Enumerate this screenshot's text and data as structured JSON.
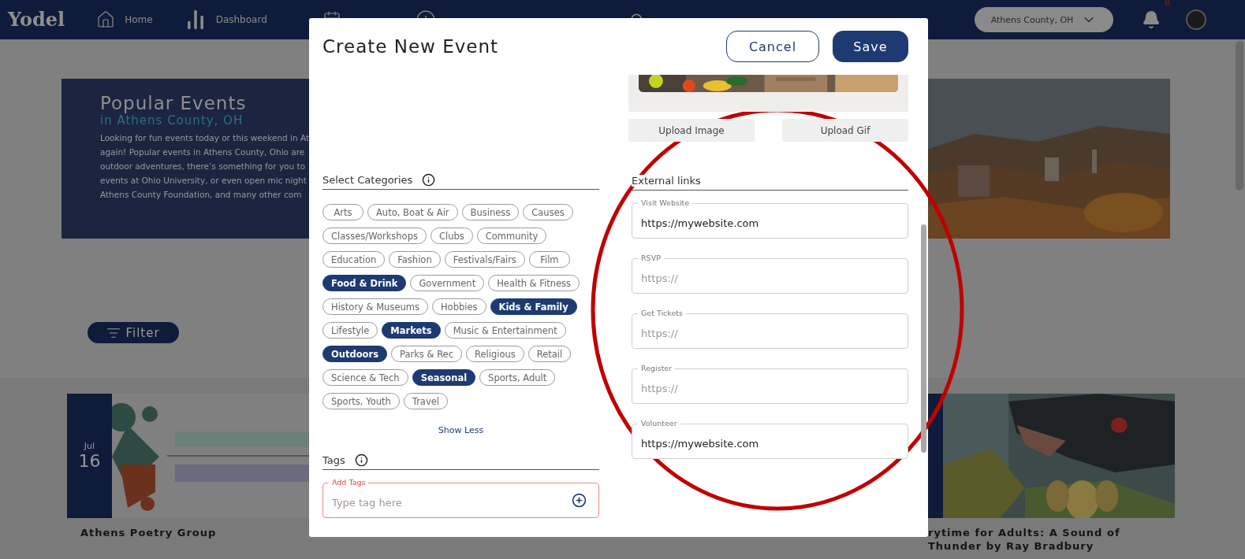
{
  "nav": {
    "logo": "Yodel",
    "items": [
      {
        "label": "Home"
      },
      {
        "label": "Dashboard"
      }
    ],
    "location": "Athens County, OH",
    "notification_count": "8"
  },
  "hero": {
    "title": "Popular Events",
    "subtitle": "in Athens County, OH",
    "lines": [
      "Looking for fun events today or this weekend in At",
      "again! Popular events in Athens County, Ohio are",
      "outdoor adventures, there’s something for you to",
      "events at Ohio University, or even open mic night",
      "Athens County Foundation, and many other com"
    ]
  },
  "filter": {
    "label": "Filter"
  },
  "cards": [
    {
      "month": "Jul",
      "day": "16",
      "title": "Athens Poetry Group"
    },
    {
      "title": "rytime for Adults: A Sound of Thunder by Ray Bradbury"
    }
  ],
  "modal": {
    "title": "Create New Event",
    "cancel": "Cancel",
    "save": "Save",
    "upload_buttons": [
      "Upload Image",
      "Upload Gif"
    ],
    "categories": {
      "heading": "Select Categories",
      "items": [
        {
          "label": "Arts",
          "selected": false
        },
        {
          "label": "Auto, Boat & Air",
          "selected": false
        },
        {
          "label": "Business",
          "selected": false
        },
        {
          "label": "Causes",
          "selected": false
        },
        {
          "label": "Classes/Workshops",
          "selected": false
        },
        {
          "label": "Clubs",
          "selected": false
        },
        {
          "label": "Community",
          "selected": false
        },
        {
          "label": "Education",
          "selected": false
        },
        {
          "label": "Fashion",
          "selected": false
        },
        {
          "label": "Festivals/Fairs",
          "selected": false
        },
        {
          "label": "Film",
          "selected": false
        },
        {
          "label": "Food & Drink",
          "selected": true
        },
        {
          "label": "Government",
          "selected": false
        },
        {
          "label": "Health & Fitness",
          "selected": false
        },
        {
          "label": "History & Museums",
          "selected": false
        },
        {
          "label": "Hobbies",
          "selected": false
        },
        {
          "label": "Kids & Family",
          "selected": true
        },
        {
          "label": "Lifestyle",
          "selected": false
        },
        {
          "label": "Markets",
          "selected": true
        },
        {
          "label": "Music & Entertainment",
          "selected": false
        },
        {
          "label": "Outdoors",
          "selected": true
        },
        {
          "label": "Parks & Rec",
          "selected": false
        },
        {
          "label": "Religious",
          "selected": false
        },
        {
          "label": "Retail",
          "selected": false
        },
        {
          "label": "Science & Tech",
          "selected": false
        },
        {
          "label": "Seasonal",
          "selected": true
        },
        {
          "label": "Sports, Adult",
          "selected": false
        },
        {
          "label": "Sports, Youth",
          "selected": false
        },
        {
          "label": "Travel",
          "selected": false
        }
      ],
      "toggle": "Show Less"
    },
    "tags": {
      "heading": "Tags",
      "field": {
        "label": "Add Tags",
        "placeholder": "Type tag here",
        "error": true
      }
    },
    "external_links": {
      "heading": "External links",
      "fields": [
        {
          "label": "Visit Website",
          "value": "https://mywebsite.com"
        },
        {
          "label": "RSVP",
          "placeholder": "https://"
        },
        {
          "label": "Get Tickets",
          "placeholder": "https://"
        },
        {
          "label": "Register",
          "placeholder": "https://"
        },
        {
          "label": "Volunteer",
          "value": "https://mywebsite.com"
        }
      ]
    }
  },
  "annotation": {
    "kind": "ellipse",
    "color": "#c00000"
  }
}
